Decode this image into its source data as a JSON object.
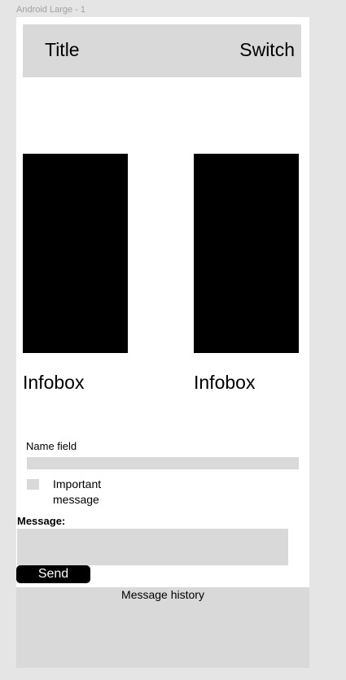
{
  "frame": {
    "label": "Android Large - 1"
  },
  "header": {
    "title": "Title",
    "switch_label": "Switch"
  },
  "infoboxes": [
    {
      "label": "Infobox"
    },
    {
      "label": "Infobox"
    }
  ],
  "form": {
    "name_label": "Name field",
    "name_value": "",
    "important_label": "Important message",
    "important_checked": false,
    "message_label": "Message:",
    "message_value": "",
    "send_label": "Send"
  },
  "history": {
    "label": "Message history"
  },
  "colors": {
    "canvas": "#e5e5e5",
    "frame": "#ffffff",
    "placeholder_gray": "#d9d9d9",
    "black": "#000000"
  }
}
